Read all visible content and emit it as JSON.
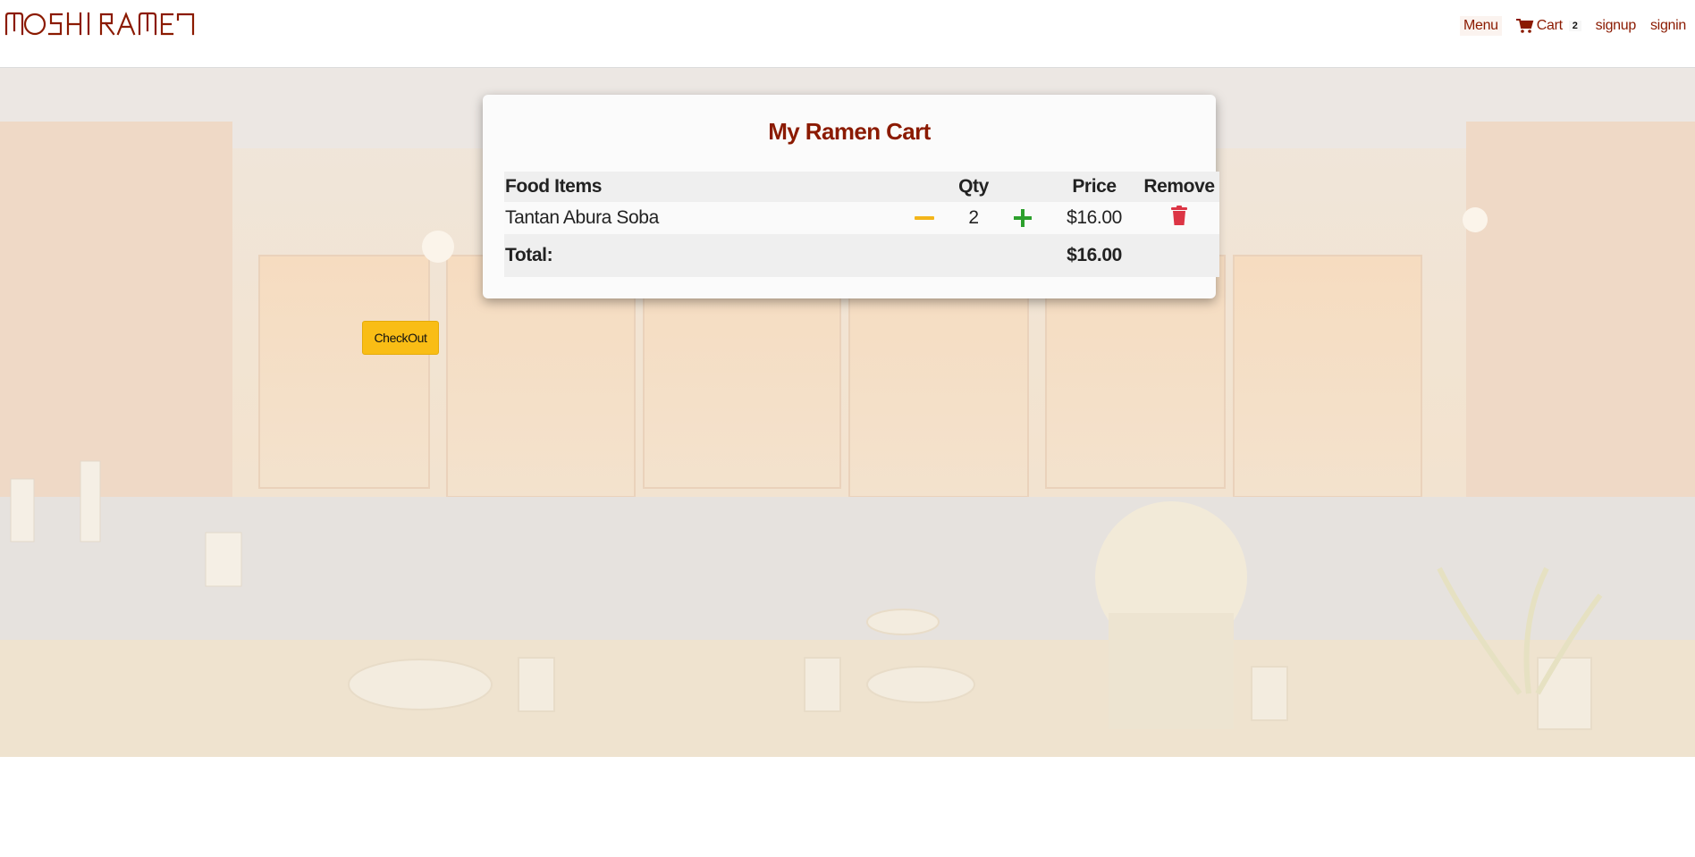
{
  "header": {
    "logo_text": "MOSHI RAMEN",
    "nav": {
      "menu_label": "Menu",
      "cart_label": "Cart",
      "cart_count": "2",
      "signup_label": "signup",
      "signin_label": "signin"
    }
  },
  "cart": {
    "title": "My Ramen Cart",
    "columns": {
      "items": "Food Items",
      "qty": "Qty",
      "price": "Price",
      "remove": "Remove"
    },
    "items": [
      {
        "name": "Tantan Abura Soba",
        "qty": "2",
        "price": "$16.00"
      }
    ],
    "total_label": "Total:",
    "total_value": "$16.00",
    "checkout_label": "CheckOut"
  },
  "colors": {
    "brand": "#8b1a00",
    "checkout": "#f9bd15",
    "minus": "#f3b51a",
    "plus": "#2ca02c",
    "trash": "#dc3545"
  },
  "icons": {
    "cart": "cart-icon",
    "minus": "minus-icon",
    "plus": "plus-icon",
    "remove": "trash-icon"
  }
}
